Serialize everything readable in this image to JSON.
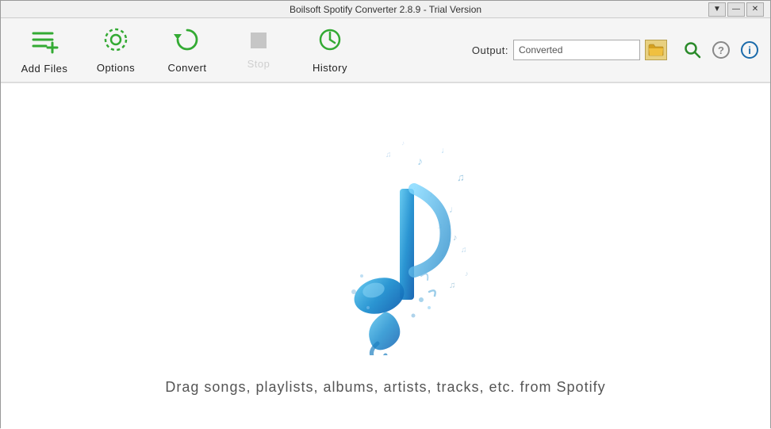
{
  "titlebar": {
    "title": "Boilsoft Spotify Converter 2.8.9 - Trial Version",
    "controls": {
      "dropdown": "▼",
      "minimize": "—",
      "close": "✕"
    }
  },
  "toolbar": {
    "add_files_label": "Add Files",
    "options_label": "Options",
    "convert_label": "Convert",
    "stop_label": "Stop",
    "history_label": "History",
    "output_label": "Output:",
    "output_value": "Converted"
  },
  "main": {
    "drag_text": "Drag songs, playlists, albums, artists, tracks, etc. from Spotify"
  },
  "icons": {
    "add_files": "≡+",
    "options": "⚙",
    "convert": "↻",
    "stop": "■",
    "history": "⏱",
    "folder": "📁",
    "search": "🔍",
    "help": "?",
    "info": "ℹ"
  }
}
